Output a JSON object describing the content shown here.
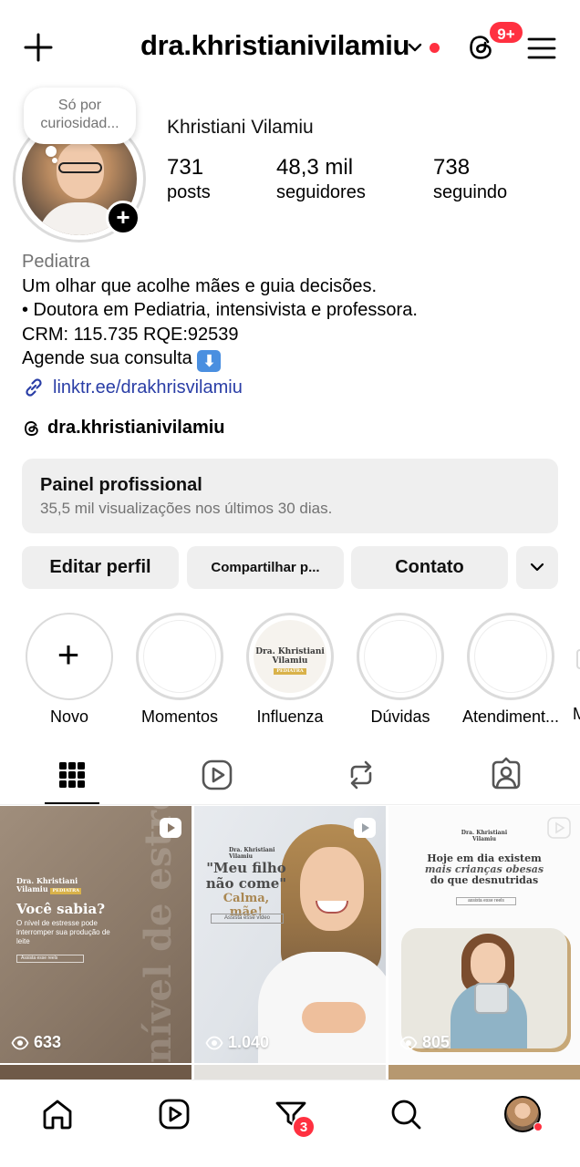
{
  "header": {
    "username": "dra.khristianivilamiu",
    "notifications_badge": "9+",
    "icons": [
      "plus-icon",
      "chevron-down-icon",
      "threads-icon",
      "menu-icon"
    ],
    "accent_color": "#ff3040"
  },
  "profile": {
    "note": "Só por curiosidad...",
    "full_name": "Khristiani Vilamiu",
    "stats": [
      {
        "value": "731",
        "label": "posts"
      },
      {
        "value": "48,3 mil",
        "label": "seguidores"
      },
      {
        "value": "738",
        "label": "seguindo"
      }
    ]
  },
  "bio": {
    "category": "Pediatra",
    "line1": "Um olhar que acolhe mães e guia decisões.",
    "line2": "• Doutora em Pediatria, intensivista e professora.",
    "line3": "CRM: 115.735 RQE:92539",
    "line4": "Agende sua consulta",
    "line4_emoji": "⬇",
    "link": "linktr.ee/drakhrisvilamiu",
    "threads_handle": "dra.khristianivilamiu",
    "link_color": "#2a3ea6"
  },
  "dashboard": {
    "title": "Painel profissional",
    "subtitle": "35,5 mil visualizações nos últimos 30 dias."
  },
  "actions": {
    "edit": "Editar perfil",
    "share": "Compartilhar p...",
    "contact": "Contato"
  },
  "highlights": [
    {
      "label": "Novo"
    },
    {
      "label": "Momentos"
    },
    {
      "label": "Influenza",
      "logo_line1": "Dra. Khristiani",
      "logo_line2": "Vilamiu",
      "logo_tag": "PEDIATRA"
    },
    {
      "label": "Dúvidas"
    },
    {
      "label": "Atendiment..."
    },
    {
      "label": "M"
    }
  ],
  "tabs": [
    "grid-icon",
    "reels-icon",
    "reposts-icon",
    "tagged-icon"
  ],
  "posts": [
    {
      "views": "633",
      "brand_line1": "Dra. Khristiani",
      "brand_line2": "Vilamiu",
      "brand_tag": "PEDIATRA",
      "headline": "Você sabia?",
      "subtext": "O nível de estresse pode interromper sua produção de leite",
      "cta": "Assista esse reels",
      "watermark": "nível de estresse"
    },
    {
      "views": "1.040",
      "brand_line1": "Dra. Khristiani",
      "brand_line2": "Vilamiu",
      "headline": "\"Meu filho não come\"",
      "headline2": "Calma, mãe!",
      "cta": "Assista esse vídeo"
    },
    {
      "views": "805",
      "brand_line1": "Dra. Khristiani",
      "brand_line2": "Vilamiu",
      "headline_a": "Hoje em dia existem",
      "headline_b": "mais crianças",
      "headline_c": "obesas",
      "headline_d": "do que desnutridas",
      "cta": "assista esse reels"
    }
  ],
  "bottom_nav": {
    "items": [
      "home-icon",
      "reels-icon",
      "activity-icon",
      "search-icon",
      "profile-avatar"
    ],
    "activity_badge": "3"
  }
}
